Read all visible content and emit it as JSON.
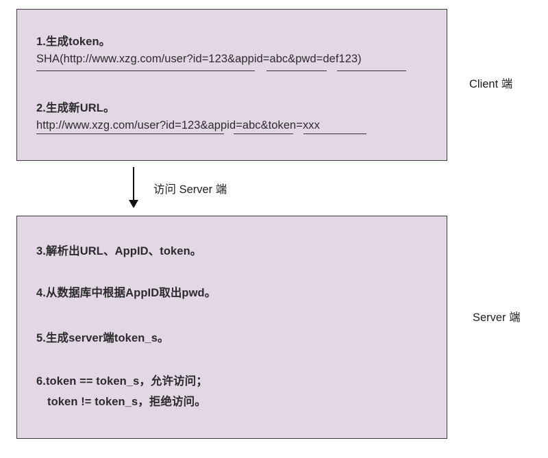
{
  "client": {
    "step1_title": "1.生成token。",
    "step1_formula": "SHA(http://www.xzg.com/user?id=123&appid=abc&pwd=def123)",
    "step2_title": "2.生成新URL。",
    "step2_url": "http://www.xzg.com/user?id=123&appid=abc&token=xxx",
    "side_label": "Client 端"
  },
  "arrow": {
    "label": "访问 Server 端"
  },
  "server": {
    "step3": "3.解析出URL、AppID、token。",
    "step4": "4.从数据库中根据AppID取出pwd。",
    "step5": "5.生成server端token_s。",
    "step6_line1": "6.token == token_s，允许访问；",
    "step6_line2": "token != token_s，拒绝访问。",
    "side_label": "Server 端"
  },
  "colors": {
    "box_fill": "#e3d7e6",
    "box_border": "#3a3a3a",
    "text": "#2b2b2b"
  }
}
